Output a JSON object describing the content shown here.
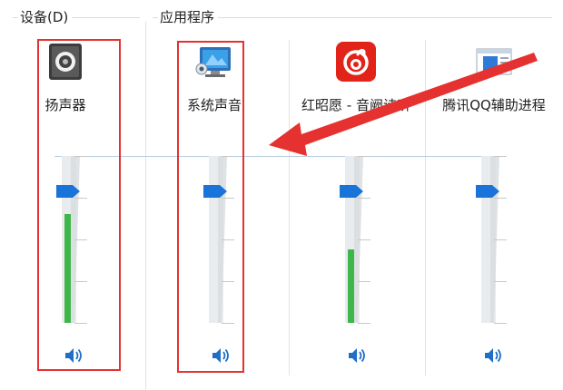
{
  "groups": {
    "devices_label": "设备(D)",
    "apps_label": "应用程序"
  },
  "channels": [
    {
      "name": "扬声器",
      "icon": "speaker-device-icon",
      "level": 0.65,
      "volume": 0.79
    },
    {
      "name": "系统声音",
      "icon": "system-sounds-icon",
      "level": 0,
      "volume": 0.79
    },
    {
      "name": "红昭愿 - 音阙诗听",
      "icon": "netease-music-app-icon",
      "level": 0.44,
      "volume": 0.79
    },
    {
      "name": "腾讯QQ辅助进程",
      "icon": "qq-helper-app-icon",
      "level": 0,
      "volume": 0.79
    }
  ],
  "colors": {
    "annotation_red": "#e5312f",
    "thumb_blue": "#1a73d9",
    "level_green": "#3fb64a",
    "netease_red": "#e2231a"
  }
}
